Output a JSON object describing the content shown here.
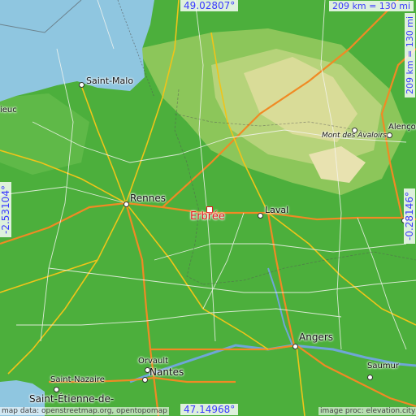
{
  "map": {
    "place_name": "Erbrée",
    "coords": {
      "top": "49.02807°",
      "bottom": "47.14968°",
      "left": "-2.53104°",
      "right": "-0.28146°"
    },
    "scale": {
      "top": "209 km = 130 mi",
      "right": "209 km = 130 mi"
    },
    "cities": [
      "Saint-Malo",
      "Rennes",
      "Laval",
      "Angers",
      "Nantes",
      "Saint-Nazaire",
      "Saint-Étienne-de-",
      "Orvault",
      "Saumur",
      "Alençon",
      "ieuc"
    ],
    "features": {
      "mountain": "Mont des Avaloirs"
    },
    "credits": {
      "left": "map data: openstreetmap.org, opentopomap",
      "right": "image proc: elevation.city"
    },
    "colors": {
      "sea": "#8fc6e0",
      "lowland": "#4caf3c",
      "upland": "#c8d88a",
      "highland": "#e8e2b0",
      "road_major": "#f0c419",
      "road_motorway": "#f08a24",
      "place_marker": "#e31a1c",
      "coord_text": "#3a3aff"
    }
  }
}
